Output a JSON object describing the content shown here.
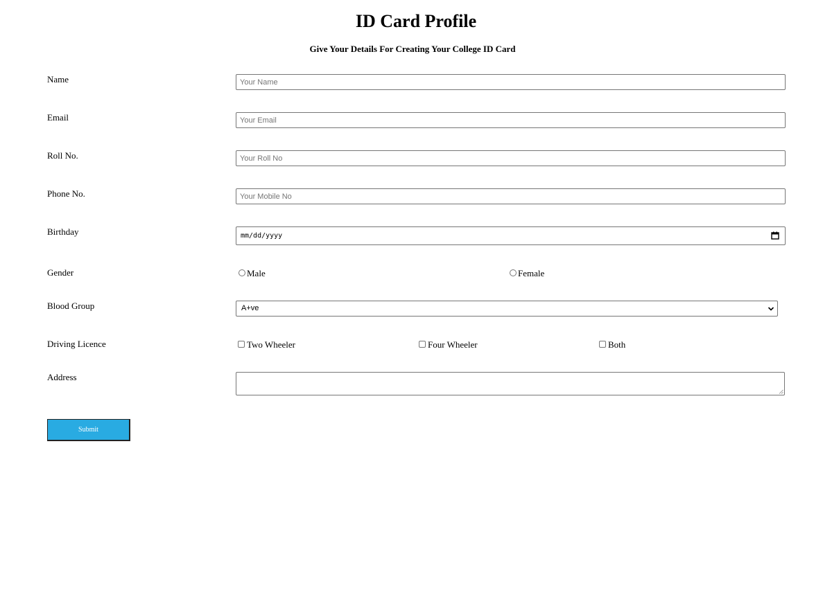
{
  "header": {
    "title": "ID Card Profile",
    "subtitle": "Give Your Details For Creating Your College ID Card"
  },
  "form": {
    "name": {
      "label": "Name",
      "placeholder": "Your Name",
      "value": ""
    },
    "email": {
      "label": "Email",
      "placeholder": "Your Email",
      "value": ""
    },
    "roll": {
      "label": "Roll No.",
      "placeholder": "Your Roll No",
      "value": ""
    },
    "phone": {
      "label": "Phone No.",
      "placeholder": "Your Mobile No",
      "value": ""
    },
    "birthday": {
      "label": "Birthday",
      "value": "mm/dd/yyyy",
      "icon": "calendar-icon"
    },
    "gender": {
      "label": "Gender",
      "options": [
        {
          "label": "Male",
          "selected": false
        },
        {
          "label": "Female",
          "selected": false
        }
      ]
    },
    "blood_group": {
      "label": "Blood Group",
      "selected": "A+ve",
      "icon": "chevron-down-icon"
    },
    "driving_licence": {
      "label": "Driving Licence",
      "options": [
        {
          "label": "Two Wheeler",
          "checked": false
        },
        {
          "label": "Four Wheeler",
          "checked": false
        },
        {
          "label": "Both",
          "checked": false
        }
      ]
    },
    "address": {
      "label": "Address",
      "value": ""
    },
    "submit_label": "Submit"
  },
  "colors": {
    "submit_bg": "#29abe2",
    "submit_text": "#ffffff",
    "input_border": "#767676"
  }
}
